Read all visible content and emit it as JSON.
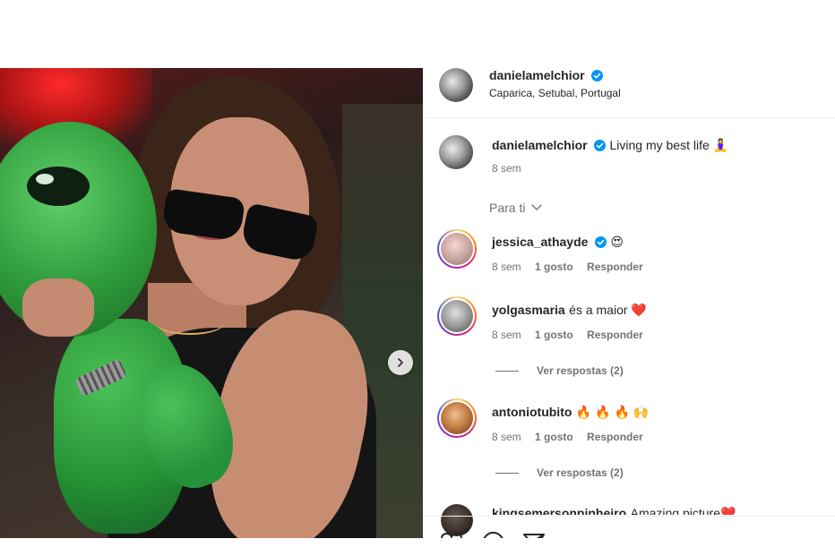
{
  "post": {
    "author": "danielamelchior",
    "location": "Caparica, Setubal, Portugal",
    "caption_author": "danielamelchior",
    "caption_text": "Living my best life 🧘‍♀️",
    "caption_time": "8 sem",
    "sort_label": "Para ti"
  },
  "comments": [
    {
      "user": "jessica_athayde",
      "verified": true,
      "text": "😍",
      "time": "8 sem",
      "likes": "1 gosto",
      "reply": "Responder"
    },
    {
      "user": "yolgasmaria",
      "verified": false,
      "text": "és a maior ❤️",
      "time": "8 sem",
      "likes": "1 gosto",
      "reply": "Responder",
      "view_replies": "Ver respostas (2)"
    },
    {
      "user": "antoniotubito",
      "verified": false,
      "text": "🔥 🔥 🔥 🙌",
      "time": "8 sem",
      "likes": "1 gosto",
      "reply": "Responder",
      "view_replies": "Ver respostas (2)"
    },
    {
      "user": "kingsemersonpinheiro",
      "verified": false,
      "text": "Amazing picture❤️"
    }
  ],
  "icons": [
    "verified-badge-icon",
    "chevron-down-icon",
    "chevron-right-icon",
    "heart-icon",
    "comment-icon",
    "share-icon"
  ],
  "colors": {
    "verified": "#0095f6",
    "muted": "#737373",
    "text": "#262626"
  }
}
